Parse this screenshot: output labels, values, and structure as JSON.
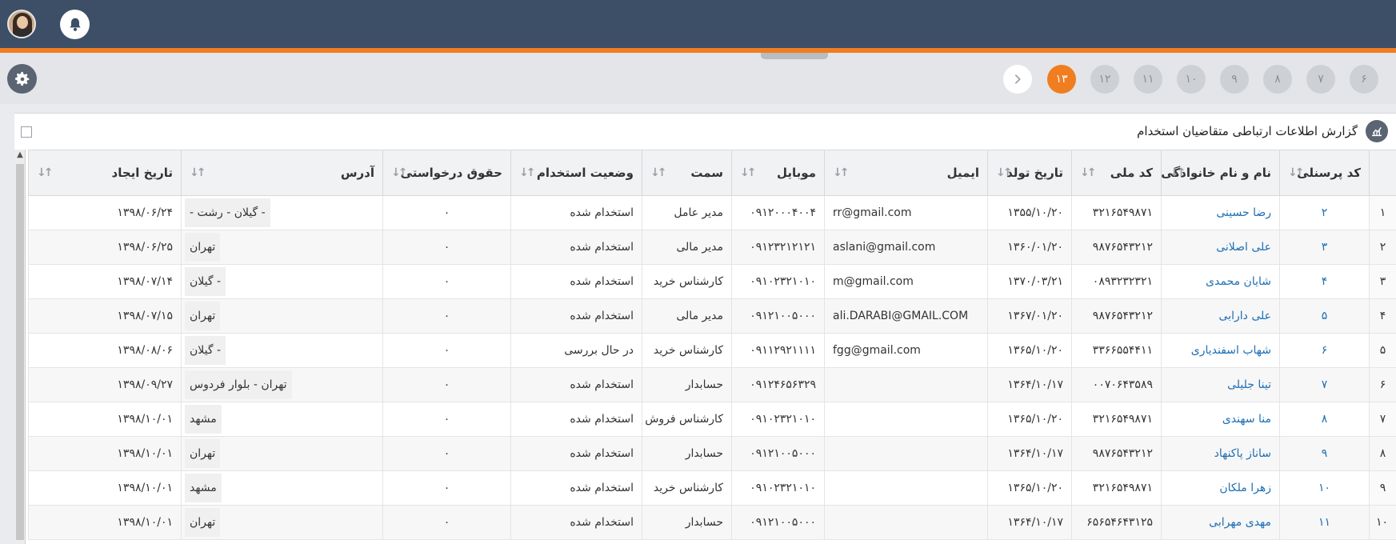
{
  "header": {
    "avatar_icon": "user-avatar",
    "notification_icon": "bell-icon"
  },
  "toolbar": {
    "settings_icon": "gear-icon",
    "pages": [
      "۱۳",
      "۱۲",
      "۱۱",
      "۱۰",
      "۹",
      "۸",
      "۷",
      "۶"
    ],
    "active_page": "۱۳",
    "next_icon": "chevron-right-icon"
  },
  "panel": {
    "title": "گزارش اطلاعات ارتباطی متقاضیان استخدام",
    "icon": "report-chart-icon"
  },
  "table": {
    "columns": [
      "کد پرسنلی",
      "نام و نام خانوادگی",
      "کد ملی",
      "تاریخ تولد",
      "ایمیل",
      "موبایل",
      "سمت",
      "وضعیت استخدام",
      "حقوق درخواستی",
      "آدرس",
      "تاریخ ایجاد"
    ],
    "rows": [
      {
        "n": "۱",
        "code": "۲",
        "name": "رضا حسینی",
        "nid": "۳۲۱۶۵۴۹۸۷۱",
        "birth": "۱۳۵۵/۱۰/۲۰",
        "email": "rr@gmail.com",
        "mobile": "۰۹۱۲۰۰۰۴۰۰۴",
        "role": "مدیر عامل",
        "status": "استخدام شده",
        "salary": "۰",
        "address": "- گیلان - رشت -",
        "created": "۱۳۹۸/۰۶/۲۴"
      },
      {
        "n": "۲",
        "code": "۳",
        "name": "علی اصلانی",
        "nid": "۹۸۷۶۵۴۳۲۱۲",
        "birth": "۱۳۶۰/۰۱/۲۰",
        "email": "aslani@gmail.com",
        "mobile": "۰۹۱۲۳۲۱۲۱۲۱",
        "role": "مدیر مالی",
        "status": "استخدام شده",
        "salary": "۰",
        "address": "تهران",
        "created": "۱۳۹۸/۰۶/۲۵"
      },
      {
        "n": "۳",
        "code": "۴",
        "name": "شایان محمدی",
        "nid": "۰۸۹۳۲۳۲۳۲۱",
        "birth": "۱۳۷۰/۰۳/۲۱",
        "email": "m@gmail.com",
        "mobile": "۰۹۱۰۲۳۲۱۰۱۰",
        "role": "کارشناس خرید",
        "status": "استخدام شده",
        "salary": "۰",
        "address": "- گیلان",
        "created": "۱۳۹۸/۰۷/۱۴"
      },
      {
        "n": "۴",
        "code": "۵",
        "name": "علی دارابی",
        "nid": "۹۸۷۶۵۴۳۲۱۲",
        "birth": "۱۳۶۷/۰۱/۲۰",
        "email": "ali.DARABI@GMAIL.COM",
        "mobile": "۰۹۱۲۱۰۰۵۰۰۰",
        "role": "مدیر مالی",
        "status": "استخدام شده",
        "salary": "۰",
        "address": "تهران",
        "created": "۱۳۹۸/۰۷/۱۵"
      },
      {
        "n": "۵",
        "code": "۶",
        "name": "شهاب اسفندیاری",
        "nid": "۳۳۶۶۵۵۴۴۱۱",
        "birth": "۱۳۶۵/۱۰/۲۰",
        "email": "fgg@gmail.com",
        "mobile": "۰۹۱۱۲۹۲۱۱۱۱",
        "role": "کارشناس خرید",
        "status": "در حال بررسی",
        "salary": "۰",
        "address": "- گیلان",
        "created": "۱۳۹۸/۰۸/۰۶"
      },
      {
        "n": "۶",
        "code": "۷",
        "name": "تینا جلیلی",
        "nid": "۰۰۷۰۶۴۳۵۸۹",
        "birth": "۱۳۶۴/۱۰/۱۷",
        "email": "",
        "mobile": "۰۹۱۲۴۶۵۶۳۲۹",
        "role": "حسابدار",
        "status": "استخدام شده",
        "salary": "۰",
        "address": "تهران - بلوار فردوس",
        "created": "۱۳۹۸/۰۹/۲۷"
      },
      {
        "n": "۷",
        "code": "۸",
        "name": "منا سهندی",
        "nid": "۳۲۱۶۵۴۹۸۷۱",
        "birth": "۱۳۶۵/۱۰/۲۰",
        "email": "",
        "mobile": "۰۹۱۰۲۳۲۱۰۱۰",
        "role": "کارشناس فروش",
        "status": "استخدام شده",
        "salary": "۰",
        "address": "مشهد",
        "created": "۱۳۹۸/۱۰/۰۱"
      },
      {
        "n": "۸",
        "code": "۹",
        "name": "ساناز پاکنهاد",
        "nid": "۹۸۷۶۵۴۳۲۱۲",
        "birth": "۱۳۶۴/۱۰/۱۷",
        "email": "",
        "mobile": "۰۹۱۲۱۰۰۵۰۰۰",
        "role": "حسابدار",
        "status": "استخدام شده",
        "salary": "۰",
        "address": "تهران",
        "created": "۱۳۹۸/۱۰/۰۱"
      },
      {
        "n": "۹",
        "code": "۱۰",
        "name": "زهرا ملکان",
        "nid": "۳۲۱۶۵۴۹۸۷۱",
        "birth": "۱۳۶۵/۱۰/۲۰",
        "email": "",
        "mobile": "۰۹۱۰۲۳۲۱۰۱۰",
        "role": "کارشناس خرید",
        "status": "استخدام شده",
        "salary": "۰",
        "address": "مشهد",
        "created": "۱۳۹۸/۱۰/۰۱"
      },
      {
        "n": "۱۰",
        "code": "۱۱",
        "name": "مهدی مهرابی",
        "nid": "۶۵۶۵۴۶۴۳۱۲۵",
        "birth": "۱۳۶۴/۱۰/۱۷",
        "email": "",
        "mobile": "۰۹۱۲۱۰۰۵۰۰۰",
        "role": "حسابدار",
        "status": "استخدام شده",
        "salary": "۰",
        "address": "تهران",
        "created": "۱۳۹۸/۱۰/۰۱"
      }
    ]
  }
}
